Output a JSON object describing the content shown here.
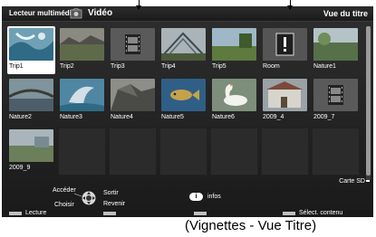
{
  "header": {
    "app_title": "Lecteur multimédia",
    "section_title": "Vidéo",
    "view_title": "Vue du titre"
  },
  "grid": {
    "items": [
      {
        "label": "Trip1",
        "kind": "photo-water"
      },
      {
        "label": "Trip2",
        "kind": "photo-landscape"
      },
      {
        "label": "Trip3",
        "kind": "film-icon"
      },
      {
        "label": "Trip4",
        "kind": "photo-structure"
      },
      {
        "label": "Trip5",
        "kind": "photo-field"
      },
      {
        "label": "Room",
        "kind": "warning-icon"
      },
      {
        "label": "Nature1",
        "kind": "photo-nature"
      },
      {
        "label": "Nature2",
        "kind": "photo-bridge"
      },
      {
        "label": "Nature3",
        "kind": "photo-dolphin"
      },
      {
        "label": "Nature4",
        "kind": "photo-rock"
      },
      {
        "label": "Nature5",
        "kind": "photo-fish"
      },
      {
        "label": "Nature6",
        "kind": "photo-swan"
      },
      {
        "label": "2009_4",
        "kind": "photo-building"
      },
      {
        "label": "2009_7",
        "kind": "film-icon"
      },
      {
        "label": "2009_9",
        "kind": "photo-nature"
      }
    ],
    "selected_index": 0
  },
  "storage": {
    "label": "Carte SD"
  },
  "help": {
    "access": "Accéder",
    "exit": "Sortir",
    "choose": "Choisir",
    "back": "Revenir",
    "info_badge": "i",
    "info": "infos"
  },
  "color_bar": {
    "play": "Lecture",
    "select_content": "Sélect. contenu"
  },
  "caption": "(Vignettes - Vue Titre)",
  "colors": {
    "background": "#222222",
    "selection": "#ffffff",
    "empty_cell": "#2b2b2b"
  }
}
